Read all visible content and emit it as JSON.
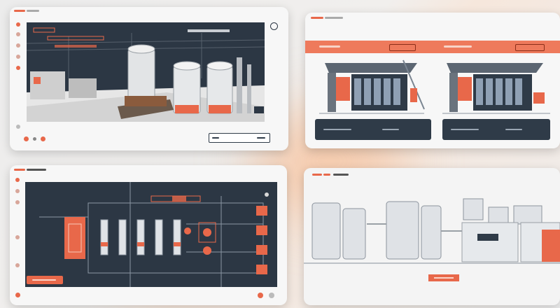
{
  "panels": {
    "p1": {
      "name": "factory-3d-view",
      "menu_text": "",
      "footer_button_text": "",
      "colors": {
        "screen": "#2c3744",
        "accent": "#e8684a"
      }
    },
    "p2": {
      "name": "building-schematics",
      "left_button_text": "",
      "left_button_right_text": "",
      "right_button_text": "",
      "right_button_right_text": ""
    },
    "p3": {
      "name": "process-diagram",
      "footer_button_text": ""
    },
    "p4": {
      "name": "tank-farm-view",
      "header_text": ""
    }
  },
  "icons": [
    "menu-icon",
    "home-icon",
    "settings-icon",
    "chart-icon",
    "user-icon",
    "search-icon"
  ],
  "colors": {
    "accent": "#e8684a",
    "dark": "#2c3744",
    "panel": "#f7f7f7"
  }
}
